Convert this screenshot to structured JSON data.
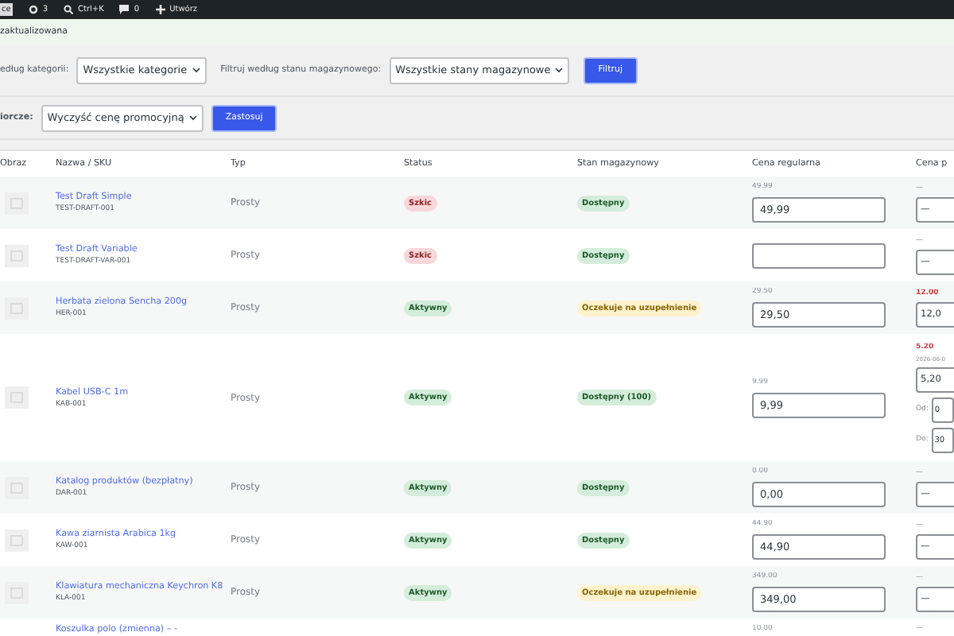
{
  "admin_bar": {
    "items": [
      {
        "kind": "site",
        "label": "ce"
      },
      {
        "kind": "updates",
        "label": "3"
      },
      {
        "kind": "search",
        "label": "Ctrl+K"
      },
      {
        "kind": "comments",
        "label": "0"
      },
      {
        "kind": "new",
        "label": "Utwórz"
      }
    ]
  },
  "notice": {
    "text": "zaktualizowana"
  },
  "filters": {
    "category_label": "edług kategorii:",
    "category_value": "Wszystkie kategorie",
    "stock_label": "Filtruj według stanu magazynowego:",
    "stock_value": "Wszystkie stany magazynowe",
    "button": "Filtruj"
  },
  "bulk": {
    "label": "iorcze:",
    "value": "Wyczyść cenę promocyjną",
    "button": "Zastosuj"
  },
  "table": {
    "columns": [
      "Obraz",
      "Nazwa / SKU",
      "Typ",
      "Status",
      "Stan magazynowy",
      "Cena regularna",
      "Cena p"
    ],
    "rows": [
      {
        "name": "Test Draft Simple",
        "sku": "TEST-DRAFT-001",
        "type": "Prosty",
        "status": {
          "label": "Szkic",
          "kind": "draft"
        },
        "stock": {
          "label": "Dostępny",
          "kind": "instock"
        },
        "regular": {
          "hint": "49.99",
          "value": "49,99"
        },
        "sale": {
          "hint": "—",
          "highlighted": false,
          "value": "—"
        }
      },
      {
        "name": "Test Draft Variable",
        "sku": "TEST-DRAFT-VAR-001",
        "type": "Prosty",
        "status": {
          "label": "Szkic",
          "kind": "draft"
        },
        "stock": {
          "label": "Dostępny",
          "kind": "instock"
        },
        "regular": {},
        "sale": {
          "hint": "—",
          "highlighted": false,
          "value": "—"
        }
      },
      {
        "name": "Herbata zielona Sencha 200g",
        "sku": "HER-001",
        "type": "Prosty",
        "status": {
          "label": "Aktywny",
          "kind": "active"
        },
        "stock": {
          "label": "Oczekuje na uzupełnienie",
          "kind": "backorder"
        },
        "regular": {
          "hint": "29.50",
          "value": "29,50"
        },
        "sale": {
          "hint": "12.00",
          "highlighted": true,
          "value": "12,0"
        }
      },
      {
        "name": "Kabel USB-C 1m",
        "sku": "KAB-001",
        "type": "Prosty",
        "status": {
          "label": "Aktywny",
          "kind": "active"
        },
        "stock": {
          "label": "Dostępny (100)",
          "kind": "instock"
        },
        "regular": {
          "hint": "9.99",
          "value": "9,99"
        },
        "sale": {
          "hint": "5.20",
          "highlighted": true,
          "date": "2026-06-0",
          "value": "5,20",
          "from_label": "Od:",
          "from": "0",
          "to_label": "Do:",
          "to": "30"
        }
      },
      {
        "name": "Katalog produktów (bezpłatny)",
        "sku": "DAR-001",
        "type": "Prosty",
        "status": {
          "label": "Aktywny",
          "kind": "active"
        },
        "stock": {
          "label": "Dostępny",
          "kind": "instock"
        },
        "regular": {
          "hint": "0.00",
          "value": "0,00"
        },
        "sale": {
          "hint": "—",
          "highlighted": false,
          "value": "—"
        }
      },
      {
        "name": "Kawa ziarnista Arabica 1kg",
        "sku": "KAW-001",
        "type": "Prosty",
        "status": {
          "label": "Aktywny",
          "kind": "active"
        },
        "stock": {
          "label": "Dostępny",
          "kind": "instock"
        },
        "regular": {
          "hint": "44.90",
          "value": "44,90"
        },
        "sale": {
          "hint": "—",
          "highlighted": false,
          "value": "—"
        }
      },
      {
        "name": "Klawiatura mechaniczna Keychron K8",
        "sku": "KLA-001",
        "type": "Prosty",
        "status": {
          "label": "Aktywny",
          "kind": "active"
        },
        "stock": {
          "label": "Oczekuje na uzupełnienie",
          "kind": "backorder"
        },
        "regular": {
          "hint": "349.00",
          "value": "349,00"
        },
        "sale": {
          "hint": "—",
          "highlighted": false,
          "value": "—"
        }
      },
      {
        "name": "Koszulka polo (zmienna) – -",
        "regular": {
          "hint": "10.00"
        },
        "sale": {
          "hint": "—",
          "highlighted": false
        }
      }
    ]
  }
}
